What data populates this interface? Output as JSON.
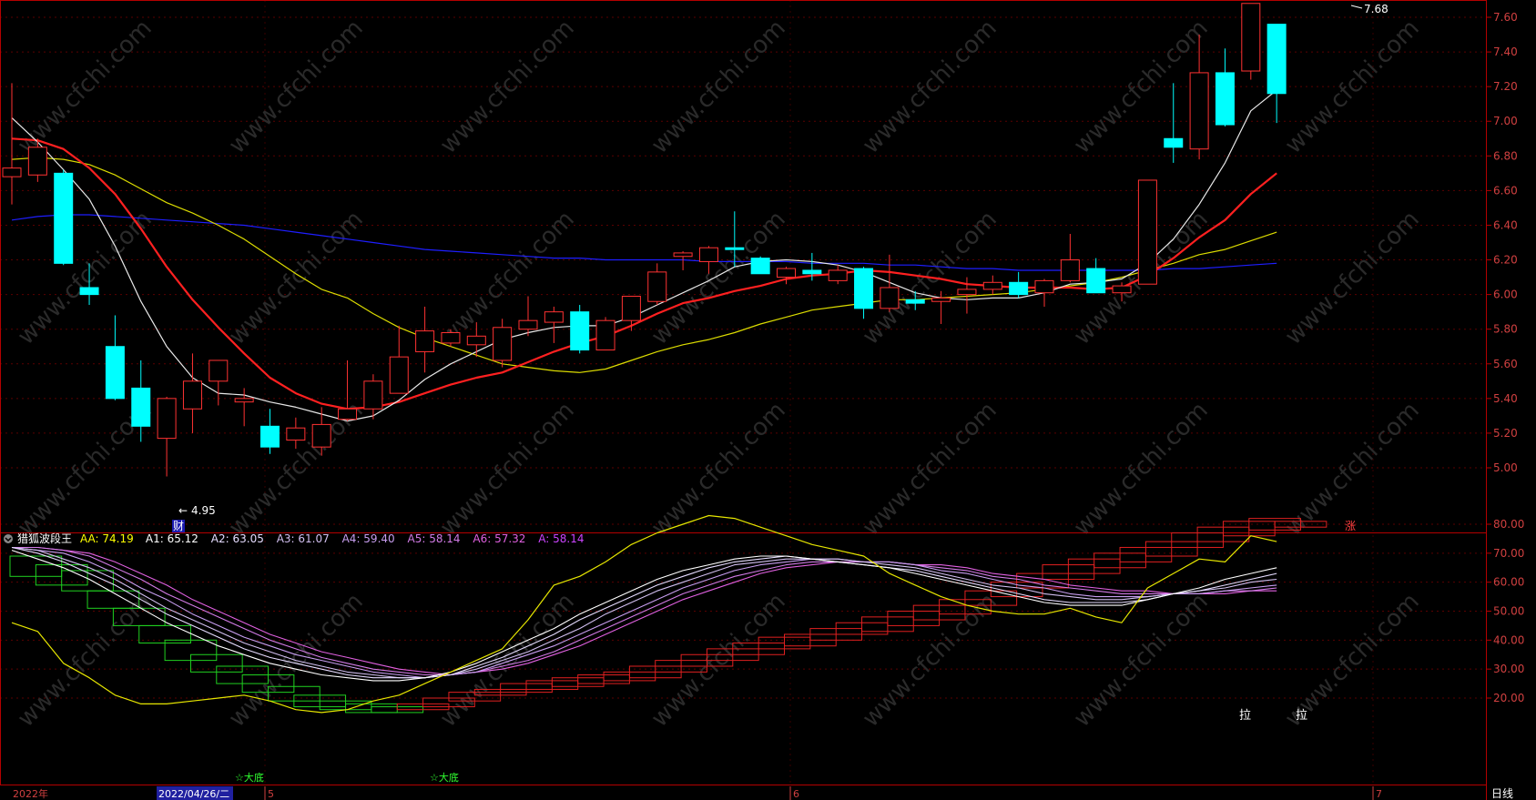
{
  "main_axis": {
    "ylim": [
      4.9,
      7.68
    ],
    "ticks": [
      "7.60",
      "7.40",
      "7.20",
      "7.00",
      "6.80",
      "6.60",
      "6.40",
      "6.20",
      "6.00",
      "5.80",
      "5.60",
      "5.40",
      "5.20",
      "5.00"
    ],
    "high_label": "7.68",
    "low_label": "4.95",
    "marker_cai": "财",
    "marker_zhang": "涨"
  },
  "indicator": {
    "name": "猎狐波段王",
    "values": [
      {
        "key": "AA",
        "label": "AA: 74.19",
        "color": "#ffff00"
      },
      {
        "key": "A1",
        "label": "A1: 65.12",
        "color": "#ffffff"
      },
      {
        "key": "A2",
        "label": "A2: 63.05",
        "color": "#e6dcff"
      },
      {
        "key": "A3",
        "label": "A3: 61.07",
        "color": "#d2bff0"
      },
      {
        "key": "A4",
        "label": "A4: 59.40",
        "color": "#c89ef0"
      },
      {
        "key": "A5",
        "label": "A5: 58.14",
        "color": "#d27be6"
      },
      {
        "key": "A6",
        "label": "A6: 57.32",
        "color": "#e060e0"
      },
      {
        "key": "A",
        "label": "A: 58.14",
        "color": "#cc44ff"
      }
    ],
    "ylim": [
      10,
      88
    ],
    "ticks": [
      "80.00",
      "70.00",
      "60.00",
      "50.00",
      "40.00",
      "30.00",
      "20.00"
    ],
    "signal_bottom": "☆大底",
    "signal_pull": "拉"
  },
  "xaxis": {
    "labels": [
      {
        "text": "2022年",
        "color": "#d04040"
      },
      {
        "text": "2022/04/26/二",
        "color": "#ffffff",
        "highlight": true
      },
      {
        "text": "5",
        "color": "#d04040"
      },
      {
        "text": "6",
        "color": "#d04040"
      },
      {
        "text": "7",
        "color": "#d04040"
      }
    ],
    "period": "日线"
  },
  "watermark": "www.cfchi.com",
  "colors": {
    "up": "#ff3232",
    "down": "#00ffff",
    "grid": "#5a0000",
    "axis": "#b40000"
  },
  "chart_data": {
    "type": "candlestick",
    "candles": [
      {
        "o": 6.68,
        "h": 7.22,
        "l": 6.52,
        "c": 6.73
      },
      {
        "o": 6.69,
        "h": 6.9,
        "l": 6.65,
        "c": 6.85
      },
      {
        "o": 6.7,
        "h": 6.72,
        "l": 6.17,
        "c": 6.18
      },
      {
        "o": 6.04,
        "h": 6.18,
        "l": 5.94,
        "c": 6.0
      },
      {
        "o": 5.7,
        "h": 5.88,
        "l": 5.39,
        "c": 5.4
      },
      {
        "o": 5.46,
        "h": 5.62,
        "l": 5.15,
        "c": 5.24
      },
      {
        "o": 5.17,
        "h": 5.41,
        "l": 4.95,
        "c": 5.4
      },
      {
        "o": 5.34,
        "h": 5.66,
        "l": 5.2,
        "c": 5.5
      },
      {
        "o": 5.5,
        "h": 5.61,
        "l": 5.36,
        "c": 5.62
      },
      {
        "o": 5.38,
        "h": 5.46,
        "l": 5.24,
        "c": 5.4
      },
      {
        "o": 5.24,
        "h": 5.34,
        "l": 5.08,
        "c": 5.12
      },
      {
        "o": 5.16,
        "h": 5.29,
        "l": 5.11,
        "c": 5.23
      },
      {
        "o": 5.12,
        "h": 5.35,
        "l": 5.07,
        "c": 5.25
      },
      {
        "o": 5.28,
        "h": 5.62,
        "l": 5.27,
        "c": 5.34
      },
      {
        "o": 5.34,
        "h": 5.54,
        "l": 5.28,
        "c": 5.5
      },
      {
        "o": 5.43,
        "h": 5.82,
        "l": 5.43,
        "c": 5.64
      },
      {
        "o": 5.67,
        "h": 5.93,
        "l": 5.55,
        "c": 5.79
      },
      {
        "o": 5.72,
        "h": 5.8,
        "l": 5.7,
        "c": 5.78
      },
      {
        "o": 5.71,
        "h": 5.84,
        "l": 5.64,
        "c": 5.76
      },
      {
        "o": 5.62,
        "h": 5.86,
        "l": 5.58,
        "c": 5.81
      },
      {
        "o": 5.8,
        "h": 5.99,
        "l": 5.76,
        "c": 5.85
      },
      {
        "o": 5.84,
        "h": 5.93,
        "l": 5.72,
        "c": 5.9
      },
      {
        "o": 5.9,
        "h": 5.94,
        "l": 5.66,
        "c": 5.68
      },
      {
        "o": 5.68,
        "h": 5.87,
        "l": 5.68,
        "c": 5.85
      },
      {
        "o": 5.85,
        "h": 5.97,
        "l": 5.79,
        "c": 5.99
      },
      {
        "o": 5.96,
        "h": 6.18,
        "l": 5.94,
        "c": 6.13
      },
      {
        "o": 6.22,
        "h": 6.25,
        "l": 6.14,
        "c": 6.24
      },
      {
        "o": 6.19,
        "h": 6.28,
        "l": 6.12,
        "c": 6.27
      },
      {
        "o": 6.27,
        "h": 6.48,
        "l": 6.16,
        "c": 6.26
      },
      {
        "o": 6.21,
        "h": 6.22,
        "l": 6.12,
        "c": 6.12
      },
      {
        "o": 6.1,
        "h": 6.16,
        "l": 6.06,
        "c": 6.15
      },
      {
        "o": 6.14,
        "h": 6.24,
        "l": 6.08,
        "c": 6.12
      },
      {
        "o": 6.08,
        "h": 6.17,
        "l": 6.06,
        "c": 6.14
      },
      {
        "o": 6.15,
        "h": 6.16,
        "l": 5.86,
        "c": 5.92
      },
      {
        "o": 5.92,
        "h": 6.23,
        "l": 5.9,
        "c": 6.04
      },
      {
        "o": 5.97,
        "h": 6.02,
        "l": 5.91,
        "c": 5.95
      },
      {
        "o": 5.96,
        "h": 6.02,
        "l": 5.83,
        "c": 5.98
      },
      {
        "o": 6.0,
        "h": 6.1,
        "l": 5.89,
        "c": 6.03
      },
      {
        "o": 6.03,
        "h": 6.11,
        "l": 6.0,
        "c": 6.07
      },
      {
        "o": 6.07,
        "h": 6.13,
        "l": 5.98,
        "c": 6.0
      },
      {
        "o": 6.01,
        "h": 6.09,
        "l": 5.93,
        "c": 6.08
      },
      {
        "o": 6.08,
        "h": 6.35,
        "l": 6.07,
        "c": 6.2
      },
      {
        "o": 6.15,
        "h": 6.21,
        "l": 6.02,
        "c": 6.01
      },
      {
        "o": 6.01,
        "h": 6.07,
        "l": 5.96,
        "c": 6.05
      },
      {
        "o": 6.06,
        "h": 6.66,
        "l": 6.06,
        "c": 6.66
      },
      {
        "o": 6.9,
        "h": 7.22,
        "l": 6.76,
        "c": 6.85
      },
      {
        "o": 6.84,
        "h": 7.5,
        "l": 6.78,
        "c": 7.28
      },
      {
        "o": 7.28,
        "h": 7.42,
        "l": 6.97,
        "c": 6.98
      },
      {
        "o": 7.29,
        "h": 7.68,
        "l": 7.24,
        "c": 7.68
      },
      {
        "o": 7.56,
        "h": 7.56,
        "l": 6.99,
        "c": 7.16
      }
    ],
    "ma_white": [
      7.02,
      6.88,
      6.72,
      6.55,
      6.28,
      5.96,
      5.7,
      5.52,
      5.43,
      5.42,
      5.38,
      5.35,
      5.31,
      5.27,
      5.3,
      5.39,
      5.51,
      5.6,
      5.67,
      5.74,
      5.78,
      5.81,
      5.82,
      5.82,
      5.87,
      5.94,
      6.01,
      6.08,
      6.16,
      6.19,
      6.2,
      6.19,
      6.17,
      6.13,
      6.07,
      6.01,
      5.98,
      5.97,
      5.98,
      5.98,
      6.01,
      6.06,
      6.07,
      6.09,
      6.18,
      6.32,
      6.52,
      6.76,
      7.06,
      7.18
    ],
    "ma_red": [
      6.9,
      6.89,
      6.84,
      6.73,
      6.58,
      6.38,
      6.16,
      5.97,
      5.81,
      5.66,
      5.52,
      5.43,
      5.37,
      5.34,
      5.35,
      5.38,
      5.43,
      5.48,
      5.52,
      5.55,
      5.61,
      5.67,
      5.72,
      5.76,
      5.82,
      5.89,
      5.95,
      5.98,
      6.02,
      6.05,
      6.09,
      6.11,
      6.12,
      6.14,
      6.13,
      6.11,
      6.09,
      6.06,
      6.05,
      6.04,
      6.04,
      6.04,
      6.03,
      6.04,
      6.11,
      6.21,
      6.33,
      6.43,
      6.58,
      6.7
    ],
    "ma_yellow": [
      6.78,
      6.79,
      6.78,
      6.75,
      6.69,
      6.61,
      6.53,
      6.47,
      6.4,
      6.32,
      6.22,
      6.12,
      6.03,
      5.98,
      5.89,
      5.81,
      5.75,
      5.7,
      5.65,
      5.6,
      5.58,
      5.56,
      5.55,
      5.57,
      5.62,
      5.67,
      5.71,
      5.74,
      5.78,
      5.83,
      5.87,
      5.91,
      5.93,
      5.95,
      5.97,
      5.97,
      5.98,
      5.99,
      6.0,
      6.01,
      6.03,
      6.05,
      6.07,
      6.1,
      6.14,
      6.18,
      6.23,
      6.26,
      6.31,
      6.36
    ],
    "ma_blue": [
      6.43,
      6.45,
      6.46,
      6.46,
      6.45,
      6.44,
      6.43,
      6.42,
      6.41,
      6.4,
      6.38,
      6.36,
      6.34,
      6.32,
      6.3,
      6.28,
      6.26,
      6.25,
      6.24,
      6.23,
      6.22,
      6.21,
      6.21,
      6.2,
      6.2,
      6.2,
      6.2,
      6.19,
      6.19,
      6.19,
      6.19,
      6.18,
      6.18,
      6.18,
      6.17,
      6.17,
      6.16,
      6.15,
      6.15,
      6.14,
      6.14,
      6.14,
      6.14,
      6.14,
      6.14,
      6.15,
      6.15,
      6.16,
      6.17,
      6.18
    ],
    "aa": [
      46,
      43,
      32,
      27,
      21,
      18,
      18,
      19,
      20,
      21,
      19,
      16,
      15,
      16,
      19,
      21,
      25,
      29,
      33,
      37,
      47,
      59,
      62,
      67,
      73,
      77,
      80,
      83,
      82,
      79,
      76,
      73,
      71,
      69,
      63,
      59,
      55,
      52,
      50,
      49,
      49,
      51,
      48,
      46,
      58,
      63,
      68,
      67,
      76,
      74
    ],
    "a_lines": [
      [
        71,
        68,
        65,
        61,
        56,
        51,
        46,
        42,
        38,
        35,
        32,
        30,
        28,
        27,
        26,
        26,
        27,
        29,
        32,
        36,
        40,
        44,
        49,
        53,
        57,
        61,
        64,
        66,
        68,
        69,
        69,
        68,
        67,
        66,
        65,
        63,
        61,
        59,
        57,
        55,
        53,
        52,
        52,
        52,
        54,
        56,
        58,
        61,
        63,
        65
      ],
      [
        72,
        70,
        67,
        63,
        59,
        54,
        49,
        45,
        41,
        37,
        34,
        32,
        30,
        28,
        27,
        27,
        27,
        28,
        31,
        34,
        38,
        42,
        47,
        51,
        55,
        59,
        62,
        65,
        67,
        68,
        69,
        68,
        67,
        66,
        65,
        64,
        62,
        60,
        58,
        56,
        54,
        53,
        53,
        53,
        54,
        56,
        57,
        59,
        61,
        63
      ],
      [
        72,
        71,
        68,
        65,
        61,
        56,
        51,
        47,
        43,
        39,
        36,
        33,
        31,
        29,
        28,
        27,
        27,
        28,
        30,
        33,
        36,
        40,
        44,
        49,
        53,
        57,
        60,
        63,
        66,
        67,
        68,
        68,
        68,
        67,
        66,
        65,
        63,
        61,
        59,
        58,
        56,
        55,
        54,
        54,
        55,
        56,
        57,
        58,
        60,
        61
      ],
      [
        72,
        71,
        70,
        67,
        63,
        58,
        54,
        49,
        45,
        41,
        38,
        35,
        33,
        31,
        29,
        28,
        27,
        28,
        29,
        32,
        35,
        38,
        42,
        46,
        50,
        54,
        58,
        61,
        64,
        66,
        67,
        68,
        68,
        67,
        67,
        66,
        64,
        63,
        61,
        59,
        58,
        56,
        55,
        55,
        55,
        56,
        56,
        57,
        58,
        59
      ],
      [
        72,
        72,
        71,
        69,
        65,
        61,
        56,
        52,
        48,
        44,
        40,
        37,
        34,
        32,
        30,
        29,
        28,
        28,
        29,
        31,
        33,
        36,
        40,
        44,
        48,
        52,
        56,
        59,
        62,
        64,
        66,
        67,
        67,
        67,
        67,
        66,
        65,
        64,
        62,
        61,
        59,
        58,
        57,
        56,
        56,
        56,
        56,
        57,
        57,
        58
      ],
      [
        72,
        72,
        71,
        70,
        67,
        63,
        59,
        54,
        50,
        46,
        42,
        39,
        36,
        34,
        32,
        30,
        29,
        28,
        29,
        30,
        32,
        35,
        38,
        42,
        46,
        50,
        54,
        57,
        60,
        63,
        65,
        66,
        67,
        67,
        67,
        66,
        66,
        65,
        63,
        62,
        61,
        59,
        58,
        57,
        57,
        56,
        56,
        56,
        57,
        57
      ]
    ],
    "step_boxes": [
      {
        "side": "down",
        "top": 69,
        "bot": 62
      },
      {
        "side": "down",
        "top": 66,
        "bot": 59
      },
      {
        "side": "down",
        "top": 64,
        "bot": 57
      },
      {
        "side": "down",
        "top": 57,
        "bot": 51
      },
      {
        "side": "down",
        "top": 51,
        "bot": 45
      },
      {
        "side": "down",
        "top": 45,
        "bot": 39
      },
      {
        "side": "down",
        "top": 40,
        "bot": 33
      },
      {
        "side": "down",
        "top": 35,
        "bot": 29
      },
      {
        "side": "down",
        "top": 31,
        "bot": 25
      },
      {
        "side": "down",
        "top": 28,
        "bot": 22
      },
      {
        "side": "down",
        "top": 24,
        "bot": 19
      },
      {
        "side": "down",
        "top": 21,
        "bot": 17
      },
      {
        "side": "down",
        "top": 19,
        "bot": 16
      },
      {
        "side": "down",
        "top": 18,
        "bot": 15
      },
      {
        "side": "down",
        "top": 17,
        "bot": 15
      },
      {
        "side": "up",
        "top": 18,
        "bot": 16
      },
      {
        "side": "up",
        "top": 20,
        "bot": 17
      },
      {
        "side": "up",
        "top": 22,
        "bot": 19
      },
      {
        "side": "up",
        "top": 23,
        "bot": 21
      },
      {
        "side": "up",
        "top": 25,
        "bot": 22
      },
      {
        "side": "up",
        "top": 26,
        "bot": 23
      },
      {
        "side": "up",
        "top": 27,
        "bot": 24
      },
      {
        "side": "up",
        "top": 28,
        "bot": 25
      },
      {
        "side": "up",
        "top": 29,
        "bot": 26
      },
      {
        "side": "up",
        "top": 31,
        "bot": 27
      },
      {
        "side": "up",
        "top": 33,
        "bot": 29
      },
      {
        "side": "up",
        "top": 35,
        "bot": 31
      },
      {
        "side": "up",
        "top": 37,
        "bot": 33
      },
      {
        "side": "up",
        "top": 39,
        "bot": 35
      },
      {
        "side": "up",
        "top": 41,
        "bot": 37
      },
      {
        "side": "up",
        "top": 42,
        "bot": 38
      },
      {
        "side": "up",
        "top": 44,
        "bot": 40
      },
      {
        "side": "up",
        "top": 46,
        "bot": 42
      },
      {
        "side": "up",
        "top": 48,
        "bot": 43
      },
      {
        "side": "up",
        "top": 50,
        "bot": 45
      },
      {
        "side": "up",
        "top": 52,
        "bot": 47
      },
      {
        "side": "up",
        "top": 54,
        "bot": 49
      },
      {
        "side": "up",
        "top": 57,
        "bot": 52
      },
      {
        "side": "up",
        "top": 60,
        "bot": 55
      },
      {
        "side": "up",
        "top": 63,
        "bot": 58
      },
      {
        "side": "up",
        "top": 66,
        "bot": 61
      },
      {
        "side": "up",
        "top": 68,
        "bot": 63
      },
      {
        "side": "up",
        "top": 70,
        "bot": 65
      },
      {
        "side": "up",
        "top": 72,
        "bot": 67
      },
      {
        "side": "up",
        "top": 74,
        "bot": 69
      },
      {
        "side": "up",
        "top": 77,
        "bot": 72
      },
      {
        "side": "up",
        "top": 79,
        "bot": 74
      },
      {
        "side": "up",
        "top": 81,
        "bot": 76
      },
      {
        "side": "up",
        "top": 82,
        "bot": 78
      },
      {
        "side": "up",
        "top": 81,
        "bot": 79
      }
    ]
  }
}
